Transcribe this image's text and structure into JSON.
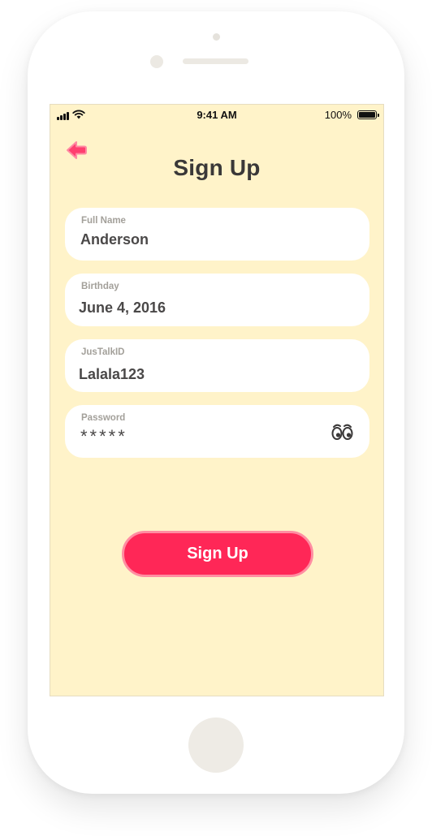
{
  "status_bar": {
    "time": "9:41 AM",
    "battery": "100%"
  },
  "header": {
    "back_icon": "back-arrow-icon",
    "title": "Sign Up"
  },
  "form": {
    "full_name": {
      "label": "Full Name",
      "value": "Anderson"
    },
    "birthday": {
      "label": "Birthday",
      "value": "June 4, 2016"
    },
    "justalk_id": {
      "label": "JusTalkID",
      "value": "Lalala123"
    },
    "password": {
      "label": "Password",
      "value": "*****",
      "toggle_icon": "eye-icon"
    }
  },
  "actions": {
    "submit_label": "Sign Up"
  },
  "colors": {
    "screen_background": "#fff3c9",
    "accent": "#ff2757",
    "accent_border": "#ff8da2",
    "title_text": "#3a3838",
    "label_text": "#a3a09a"
  }
}
